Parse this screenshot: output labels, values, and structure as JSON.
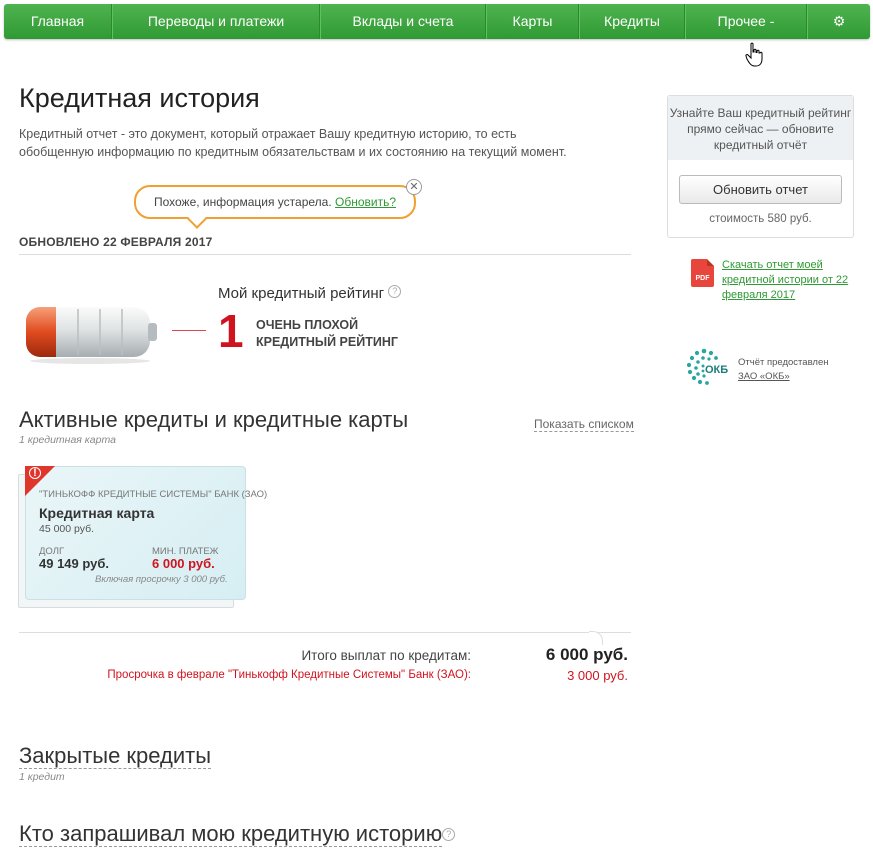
{
  "nav": {
    "items": [
      "Главная",
      "Переводы и платежи",
      "Вклады и счета",
      "Карты",
      "Кредиты",
      "Прочее -"
    ],
    "settings_icon": "gear-icon"
  },
  "page": {
    "title": "Кредитная история",
    "intro": "Кредитный отчет - это документ, который отражает Вашу кредитную историю, то есть обобщенную информацию по кредитным обязательствам и их состоянию на текущий момент."
  },
  "notice": {
    "text": "Похоже, информация устарела.",
    "link": "Обновить?"
  },
  "updated": "ОБНОВЛЕНО 22 ФЕВРАЛЯ 2017",
  "rating": {
    "title": "Мой кредитный рейтинг",
    "value": "1",
    "text": "ОЧЕНЬ ПЛОХОЙ КРЕДИТНЫЙ РЕЙТИНГ",
    "level": 0.2
  },
  "active": {
    "title": "Активные кредиты и кредитные карты",
    "subtitle": "1 кредитная карта",
    "show_list": "Показать списком",
    "card": {
      "bank": "\"ТИНЬКОФФ КРЕДИТНЫЕ СИСТЕМЫ\" БАНК (ЗАО)",
      "name": "Кредитная карта",
      "limit": "45 000 руб.",
      "debt_label": "ДОЛГ",
      "debt_value": "49 149 руб.",
      "min_label": "МИН. ПЛАТЕЖ",
      "min_value": "6 000 руб.",
      "note": "Включая просрочку 3 000 руб."
    }
  },
  "totals": {
    "label": "Итого выплат по кредитам:",
    "value": "6 000 руб.",
    "overdue_label": "Просрочка в феврале \"Тинькофф Кредитные Системы\" Банк (ЗАО):",
    "overdue_value": "3 000 руб."
  },
  "closed": {
    "title": "Закрытые кредиты",
    "subtitle": "1 кредит"
  },
  "requests": {
    "title": "Кто запрашивал мою кредитную историю"
  },
  "sidebar": {
    "promo": "Узнайте Ваш кредитный рейтинг прямо сейчас — обновите кредитный отчёт",
    "button": "Обновить отчет",
    "price": "стоимость 580 руб.",
    "pdf_badge": "PDF",
    "pdf_link": "Скачать отчет моей кредитной истории от 22 февраля 2017",
    "okb_caption": "Отчёт предоставлен",
    "okb_link": "ЗАО «ОКБ»",
    "okb_logo_text": "ОКБ"
  },
  "colors": {
    "nav_green": "#2f9a33",
    "accent_red": "#d0141f",
    "link_green": "#2e9a33",
    "notice_orange": "#f0a030"
  }
}
